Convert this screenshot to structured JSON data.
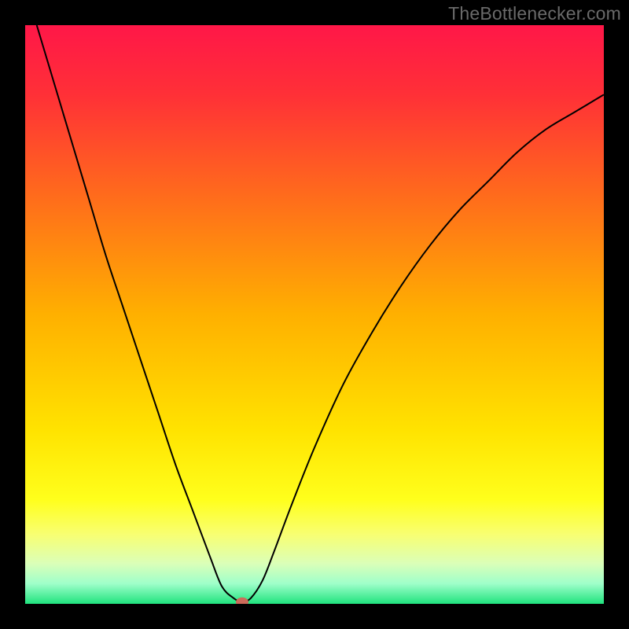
{
  "watermark": {
    "text": "TheBottlenecker.com"
  },
  "chart_data": {
    "type": "line",
    "title": "",
    "xlabel": "",
    "ylabel": "",
    "xlim": [
      0,
      100
    ],
    "ylim": [
      0,
      100
    ],
    "legend": false,
    "grid": false,
    "background_gradient": {
      "stops": [
        {
          "offset": 0.0,
          "color": "#ff1748"
        },
        {
          "offset": 0.12,
          "color": "#ff3037"
        },
        {
          "offset": 0.3,
          "color": "#ff6d1b"
        },
        {
          "offset": 0.5,
          "color": "#ffb000"
        },
        {
          "offset": 0.7,
          "color": "#ffe300"
        },
        {
          "offset": 0.82,
          "color": "#ffff1c"
        },
        {
          "offset": 0.88,
          "color": "#f8ff72"
        },
        {
          "offset": 0.93,
          "color": "#dbffb8"
        },
        {
          "offset": 0.965,
          "color": "#9fffca"
        },
        {
          "offset": 1.0,
          "color": "#20e37e"
        }
      ]
    },
    "series": [
      {
        "name": "bottleneck-curve",
        "color": "#000000",
        "stroke_width": 2,
        "x": [
          2,
          5,
          8,
          11,
          14,
          17,
          20,
          23,
          26,
          29,
          32,
          34,
          36,
          37.5,
          39,
          41,
          43,
          46,
          50,
          55,
          60,
          65,
          70,
          75,
          80,
          85,
          90,
          95,
          100
        ],
        "y": [
          100,
          90,
          80,
          70,
          60,
          51,
          42,
          33,
          24,
          16,
          8,
          3,
          1,
          0.3,
          1,
          4,
          9,
          17,
          27,
          38,
          47,
          55,
          62,
          68,
          73,
          78,
          82,
          85,
          88
        ]
      }
    ],
    "marker": {
      "name": "optimum-point",
      "x": 37.5,
      "y": 0.3,
      "color": "#cc6b5a",
      "rx": 8,
      "ry": 6
    }
  }
}
